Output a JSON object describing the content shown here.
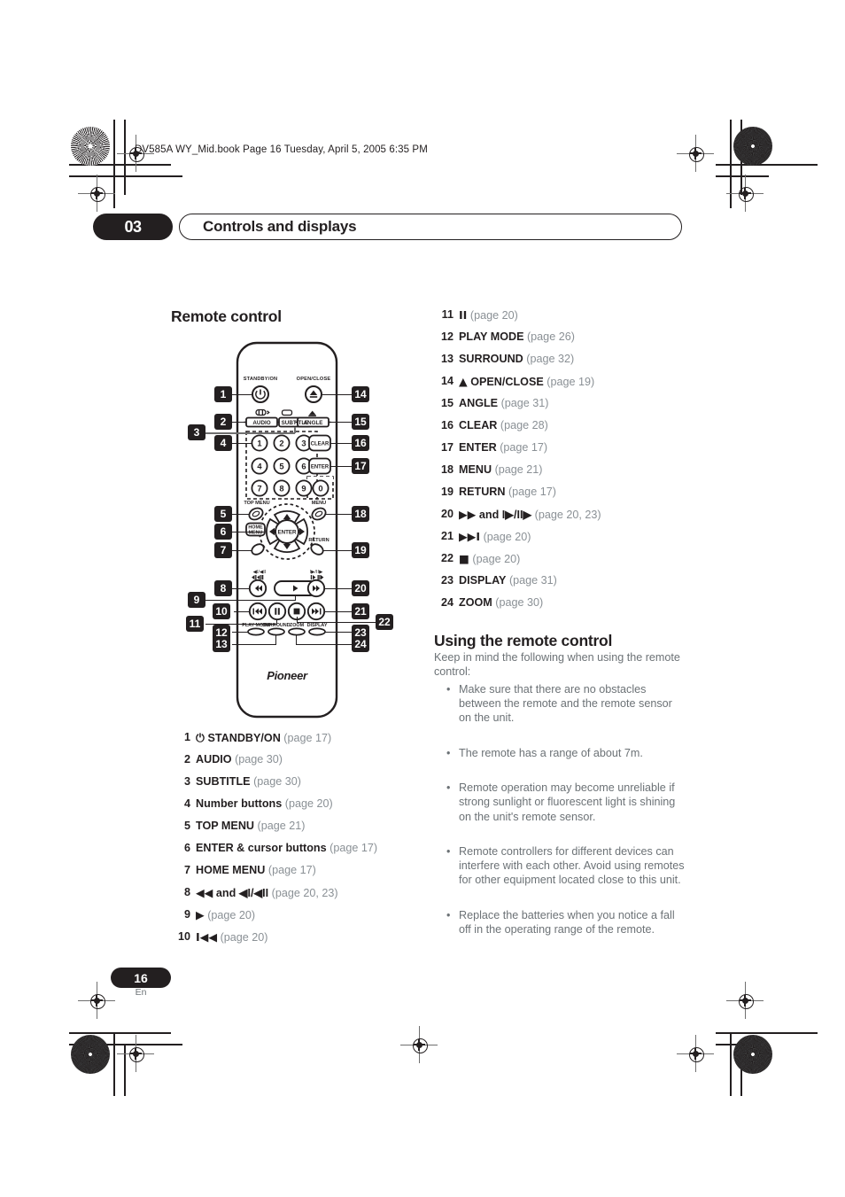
{
  "print_header": {
    "book_line": "DV585A WY_Mid.book  Page 16  Tuesday, April 5, 2005  6:35 PM"
  },
  "chapter_bar": {
    "number": "03",
    "title": "Controls and displays"
  },
  "main": {
    "section_title": "Remote control",
    "subsection_title": "Using the remote control",
    "intro": "Keep in mind the following when using the remote control:"
  },
  "callouts_left": [
    "1",
    "2",
    "3",
    "4",
    "5",
    "6",
    "7",
    "8",
    "9",
    "10",
    "11",
    "12",
    "13"
  ],
  "callouts_right": [
    "14",
    "15",
    "16",
    "17",
    "18",
    "19",
    "20",
    "21",
    "22",
    "23",
    "24"
  ],
  "remote": {
    "labels": {
      "standby": "STANDBY/ON",
      "open_close": "OPEN/CLOSE",
      "audio": "AUDIO",
      "subtitle": "SUBTITLE",
      "angle": "ANGLE",
      "clear": "CLEAR",
      "enter_btn": "ENTER",
      "top_menu": "TOP MENU",
      "menu": "MENU",
      "home_menu_1": "HOME",
      "home_menu_2": "MENU",
      "return": "RETURN",
      "enter_pad": "ENTER",
      "play_mode": "PLAY MODE",
      "surround": "SURROUND",
      "zoom": "ZOOM",
      "display": "DISPLAY",
      "scan_rev": "◀I / ◀II",
      "scan_fwd": "I▶ / II▶",
      "brand": "Pioneer"
    },
    "number_keys": [
      "1",
      "2",
      "3",
      "4",
      "5",
      "6",
      "7",
      "8",
      "9",
      "0"
    ]
  },
  "list_left": [
    {
      "n": "1",
      "sym": "⏻",
      "bold": "STANDBY/ON",
      "page": "(page 17)"
    },
    {
      "n": "2",
      "sym": "",
      "bold": "AUDIO",
      "page": "(page 30)"
    },
    {
      "n": "3",
      "sym": "",
      "bold": "SUBTITLE",
      "page": "(page 30)"
    },
    {
      "n": "4",
      "sym": "",
      "bold": "Number buttons",
      "page": "(page 20)"
    },
    {
      "n": "5",
      "sym": "",
      "bold": "TOP MENU",
      "page": "(page 21)"
    },
    {
      "n": "6",
      "sym": "",
      "bold": "ENTER & cursor buttons",
      "page": "(page 17)"
    },
    {
      "n": "7",
      "sym": "",
      "bold": "HOME MENU",
      "page": "(page 17)"
    },
    {
      "n": "8",
      "sym": "◀◀",
      "bold": "and ◀I/◀II",
      "page": "(page 20, 23)"
    },
    {
      "n": "9",
      "sym": "▶",
      "bold": "",
      "page": "(page 20)"
    },
    {
      "n": "10",
      "sym": "I◀◀",
      "bold": "",
      "page": "(page 20)"
    }
  ],
  "list_right": [
    {
      "n": "11",
      "sym": "II",
      "bold": "",
      "page": "(page 20)"
    },
    {
      "n": "12",
      "sym": "",
      "bold": "PLAY MODE",
      "page": "(page 26)"
    },
    {
      "n": "13",
      "sym": "",
      "bold": "SURROUND",
      "page": "(page 32)"
    },
    {
      "n": "14",
      "sym": "▲",
      "bold": "OPEN/CLOSE",
      "page": "(page 19)"
    },
    {
      "n": "15",
      "sym": "",
      "bold": "ANGLE",
      "page": "(page 31)"
    },
    {
      "n": "16",
      "sym": "",
      "bold": "CLEAR",
      "page": "(page 28)"
    },
    {
      "n": "17",
      "sym": "",
      "bold": "ENTER",
      "page": "(page 17)"
    },
    {
      "n": "18",
      "sym": "",
      "bold": "MENU",
      "page": "(page 21)"
    },
    {
      "n": "19",
      "sym": "",
      "bold": "RETURN",
      "page": "(page 17)"
    },
    {
      "n": "20",
      "sym": "▶▶",
      "bold": "and I▶/II▶",
      "page": "(page 20, 23)"
    },
    {
      "n": "21",
      "sym": "▶▶I",
      "bold": "",
      "page": "(page 20)"
    },
    {
      "n": "22",
      "sym": "■",
      "bold": "",
      "page": "(page 20)"
    },
    {
      "n": "23",
      "sym": "",
      "bold": "DISPLAY",
      "page": "(page 31)"
    },
    {
      "n": "24",
      "sym": "",
      "bold": "ZOOM",
      "page": "(page 30)"
    }
  ],
  "bullets": [
    "Make sure that there are no obstacles between the remote and the remote sensor on the unit.",
    "The remote has a range of about 7m.",
    "Remote operation may become unreliable if strong sunlight or fluorescent light is shining on the unit's remote sensor.",
    "Remote controllers for different devices can interfere with each other. Avoid using remotes for other equipment located close to this unit.",
    "Replace the batteries when you notice a fall off in the operating range of the remote."
  ],
  "footer": {
    "page_number": "16",
    "language": "En"
  }
}
